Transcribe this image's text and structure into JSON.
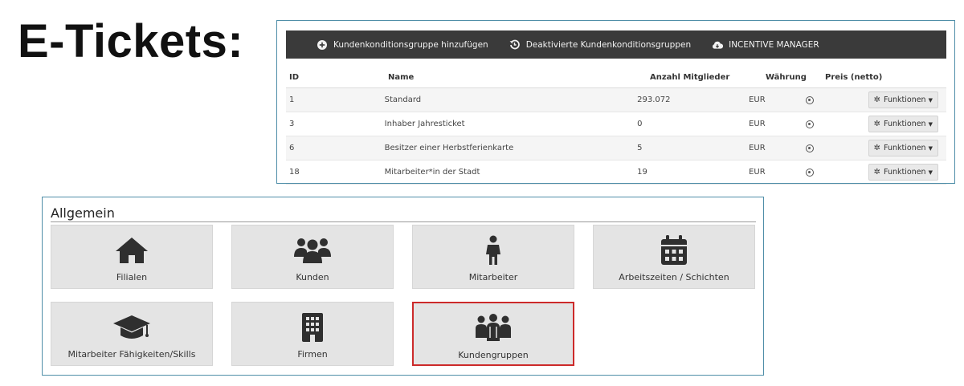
{
  "heading": "E-Tickets:",
  "toolbar": {
    "add_group": "Kundenkonditionsgruppe hinzufügen",
    "deactivated": "Deaktivierte Kundenkonditionsgruppen",
    "incentive": "INCENTIVE MANAGER"
  },
  "table": {
    "columns": [
      "ID",
      "Name",
      "Anzahl Mitglieder",
      "Währung",
      "Preis (netto)"
    ],
    "rows": [
      {
        "id": "1",
        "name": "Standard",
        "count": "293.072",
        "currency": "EUR",
        "action": "Funktionen"
      },
      {
        "id": "3",
        "name": "Inhaber Jahresticket",
        "count": "0",
        "currency": "EUR",
        "action": "Funktionen"
      },
      {
        "id": "6",
        "name": "Besitzer einer Herbstferienkarte",
        "count": "5",
        "currency": "EUR",
        "action": "Funktionen"
      },
      {
        "id": "18",
        "name": "Mitarbeiter*in der Stadt",
        "count": "19",
        "currency": "EUR",
        "action": "Funktionen"
      }
    ]
  },
  "general": {
    "title": "Allgemein",
    "tiles": [
      {
        "label": "Filialen",
        "icon": "home-icon"
      },
      {
        "label": "Kunden",
        "icon": "users-icon"
      },
      {
        "label": "Mitarbeiter",
        "icon": "person-icon"
      },
      {
        "label": "Arbeitszeiten / Schichten",
        "icon": "calendar-icon"
      },
      {
        "label": "Mitarbeiter Fähigkeiten/Skills",
        "icon": "graduation-cap-icon"
      },
      {
        "label": "Firmen",
        "icon": "building-icon"
      },
      {
        "label": "Kundengruppen",
        "icon": "customer-groups-icon",
        "selected": true
      }
    ]
  },
  "colors": {
    "toolbar_bg": "#3a3a3a",
    "tile_bg": "#e4e4e4",
    "selected_border": "#cc2a2a",
    "panel_border": "#4f8ea8"
  }
}
